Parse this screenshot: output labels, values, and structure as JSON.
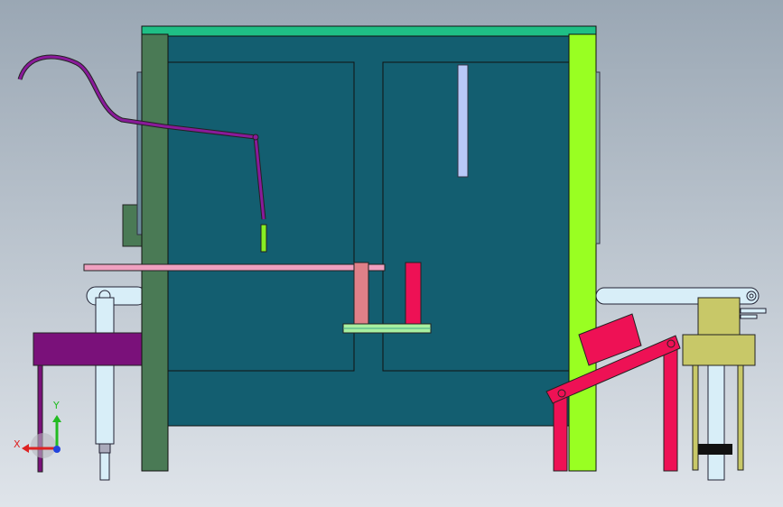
{
  "viewport": {
    "background_top": "#9aa7b4",
    "background_bottom": "#dfe4ea"
  },
  "colors": {
    "cabinet_body": "#135e70",
    "cabinet_top": "#1fbf85",
    "left_frame": "#4a7a55",
    "right_frame": "#99ff22",
    "purple": "#7a117a",
    "pink_rod": "#f0a0c0",
    "salmon": "#e08088",
    "crimson": "#ee1155",
    "light_green": "#a8f0a0",
    "light_blue": "#d8eef8",
    "olive": "#c8c868",
    "lavender": "#b8c8f8",
    "lime": "#88ee22"
  },
  "triad": {
    "x_label": "X",
    "y_label": "Y",
    "x_color": "#dd2222",
    "y_color": "#22bb22",
    "z_color": "#2244dd"
  }
}
